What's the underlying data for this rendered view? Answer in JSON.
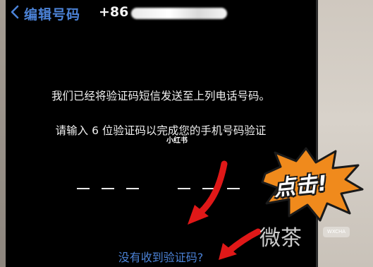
{
  "nav": {
    "back_label": "编辑号码",
    "title": "+86"
  },
  "message": {
    "line1": "我们已经将验证码短信发送至上列电话号码。",
    "line2": "请输入 6 位验证码以完成您的手机号码验证"
  },
  "code_input": {
    "digits": 6,
    "placeholder_char": "—"
  },
  "resend": {
    "label": "没有收到验证码?"
  },
  "overlay": {
    "click_label": "点击!",
    "watermark_xhs": "小红书",
    "watermark_script": "微茶",
    "watermark_badge": "WXCHA"
  },
  "colors": {
    "link_blue": "#4b82d6",
    "screen_bg": "#000000",
    "arrow_red": "#e01818",
    "badge_orange": "#f08a1c"
  },
  "icons": {
    "back": "chevron-left-icon",
    "arrow": "red-arrow-icon"
  }
}
